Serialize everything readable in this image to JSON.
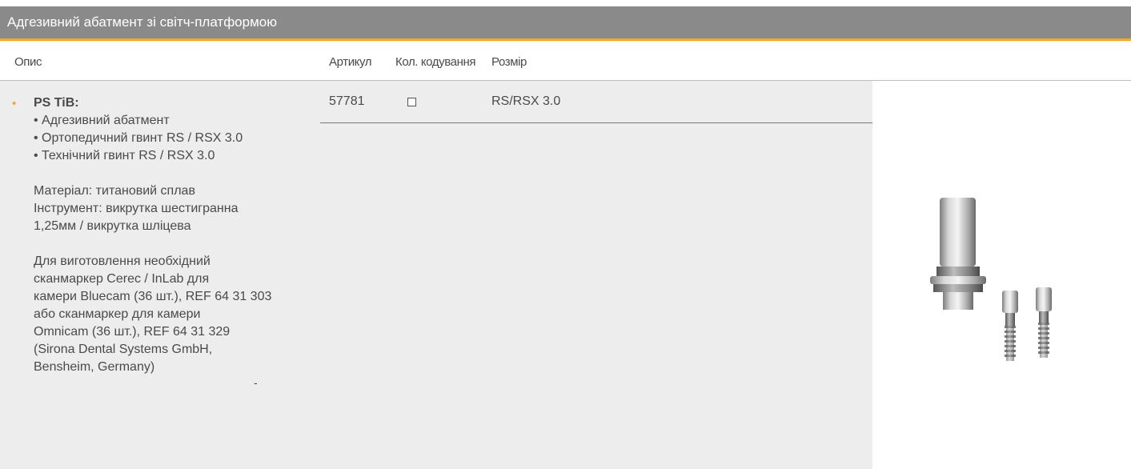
{
  "header": {
    "title": "Адгезивний абатмент зі світч-платформою"
  },
  "columns": {
    "description": "Опис",
    "article": "Артикул",
    "color_coding": "Кол. кодування",
    "size": "Розмір"
  },
  "row": {
    "name": "PS TiB:",
    "components": [
      "• Адгезивний абатмент",
      "• Ортопедичний гвинт RS / RSX 3.0",
      "• Технічний гвинт RS / RSX 3.0"
    ],
    "material": "Матеріал: титановий сплав",
    "instrument_lines": [
      "Інструмент: викрутка шестигранна",
      "1,25мм / викрутка шліцева"
    ],
    "manufacturing_lines": [
      "Для виготовлення необхідний",
      "сканмаркер Cerec / InLab для",
      "камери Bluecam (36 шт.), REF 64 31 303",
      "або сканмаркер для камери",
      "Omnicam (36 шт.), REF 64 31 329",
      "(Sirona Dental Systems GmbH,",
      "Bensheim, Germany)"
    ],
    "article": "57781",
    "size": "RS/RSX 3.0",
    "stray_mark": "-"
  },
  "colors": {
    "title_bar": "#8a8a8a",
    "accent": "#f0a82e",
    "row_background": "#ededed"
  },
  "icons": {
    "bullet": "bullet-icon",
    "color_box": "checkbox-icon",
    "image": "abutment-with-screws"
  }
}
